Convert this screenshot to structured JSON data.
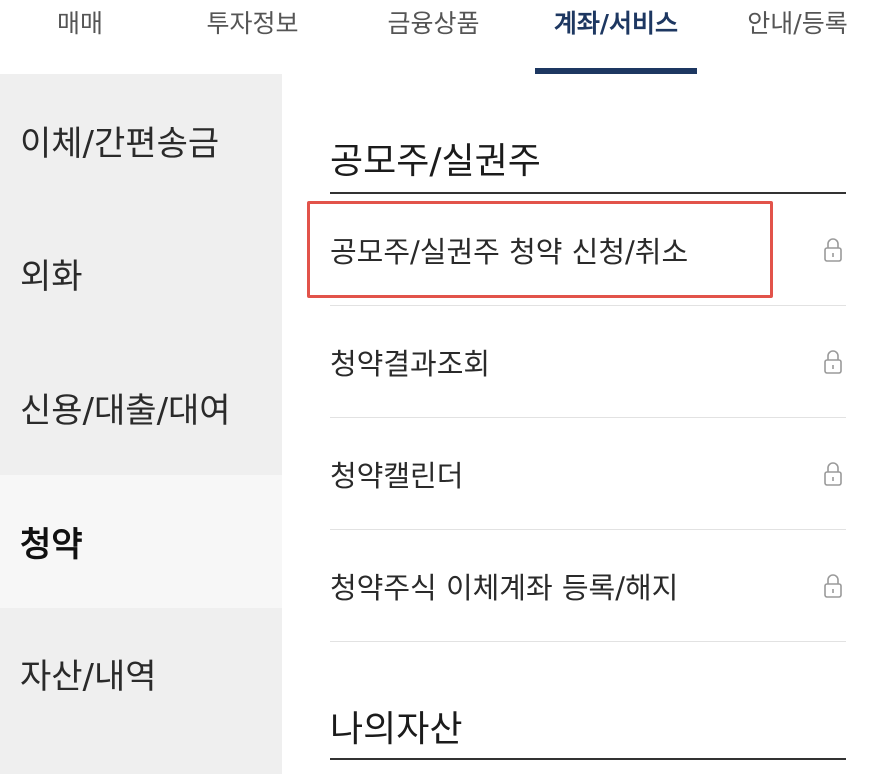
{
  "topnav": {
    "tabs": [
      {
        "label": "매매"
      },
      {
        "label": "투자정보"
      },
      {
        "label": "금융상품"
      },
      {
        "label": "계좌/서비스"
      },
      {
        "label": "안내/등록"
      }
    ],
    "active_index": 3
  },
  "sidebar": {
    "items": [
      {
        "label": "이체/간편송금"
      },
      {
        "label": "외화"
      },
      {
        "label": "신용/대출/대여"
      },
      {
        "label": "청약"
      },
      {
        "label": "자산/내역"
      }
    ],
    "active_index": 3
  },
  "main": {
    "sections": [
      {
        "title": "공모주/실권주",
        "items": [
          {
            "label": "공모주/실권주 청약 신청/취소",
            "icon": "lock-icon",
            "highlighted": true
          },
          {
            "label": "청약결과조회",
            "icon": "lock-icon"
          },
          {
            "label": "청약캘린더",
            "icon": "lock-icon"
          },
          {
            "label": "청약주식 이체계좌 등록/해지",
            "icon": "lock-icon"
          }
        ]
      },
      {
        "title": "나의자산",
        "items": []
      }
    ]
  },
  "colors": {
    "accent_navy": "#1d3761",
    "highlight_red": "#e2534a",
    "sidebar_bg": "#efefef"
  }
}
